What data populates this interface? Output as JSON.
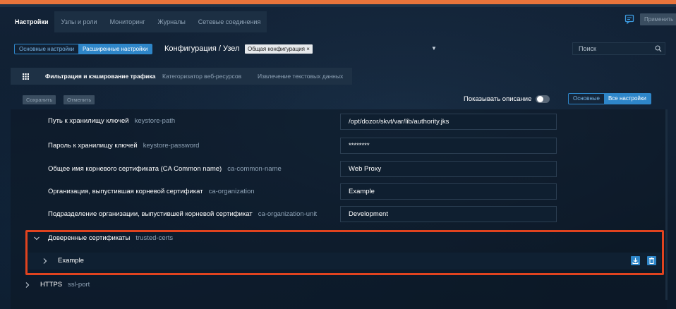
{
  "main_tabs": [
    "Настройки",
    "Узлы и роли",
    "Мониторинг",
    "Журналы",
    "Сетевые соединения"
  ],
  "apply_label": "Применить",
  "mode_switch": {
    "basic": "Основные настройки",
    "advanced": "Расширенные настройки"
  },
  "config_title": "Конфигурация / Узел",
  "config_tag": "Общая конфигурация ×",
  "search_placeholder": "Поиск",
  "sub_tabs": [
    "Фильтрация и кэширование трафика",
    "Категоризатор веб-ресурсов",
    "Извлечение текстовых данных"
  ],
  "toolbar": {
    "save": "Сохранить",
    "cancel": "Отменить",
    "show_description": "Показывать описание"
  },
  "view_switch": {
    "basic": "Основные",
    "all": "Все настройки"
  },
  "settings": [
    {
      "label": "Путь к хранилищу ключей",
      "key": "keystore-path",
      "value": "/opt/dozor/skvt/var/lib/authority.jks"
    },
    {
      "label": "Пароль к хранилищу ключей",
      "key": "keystore-password",
      "value": "********"
    },
    {
      "label": "Общее имя корневого сертификата (CA Common name)",
      "key": "ca-common-name",
      "value": "Web Proxy"
    },
    {
      "label": "Организация, выпустившая корневой сертификат",
      "key": "ca-organization",
      "value": "Example"
    },
    {
      "label": "Подразделение организации, выпустившей корневой сертификат",
      "key": "ca-organization-unit",
      "value": "Development"
    }
  ],
  "trusted_section": {
    "label": "Доверенные сертификаты",
    "key": "trusted-certs"
  },
  "trusted_item": {
    "label": "Example"
  },
  "https_section": {
    "label": "HTTPS",
    "key": "ssl-port"
  },
  "colors": {
    "accent": "#2e86c9",
    "highlight": "#e0431f",
    "top_bar": "#e8743b"
  }
}
